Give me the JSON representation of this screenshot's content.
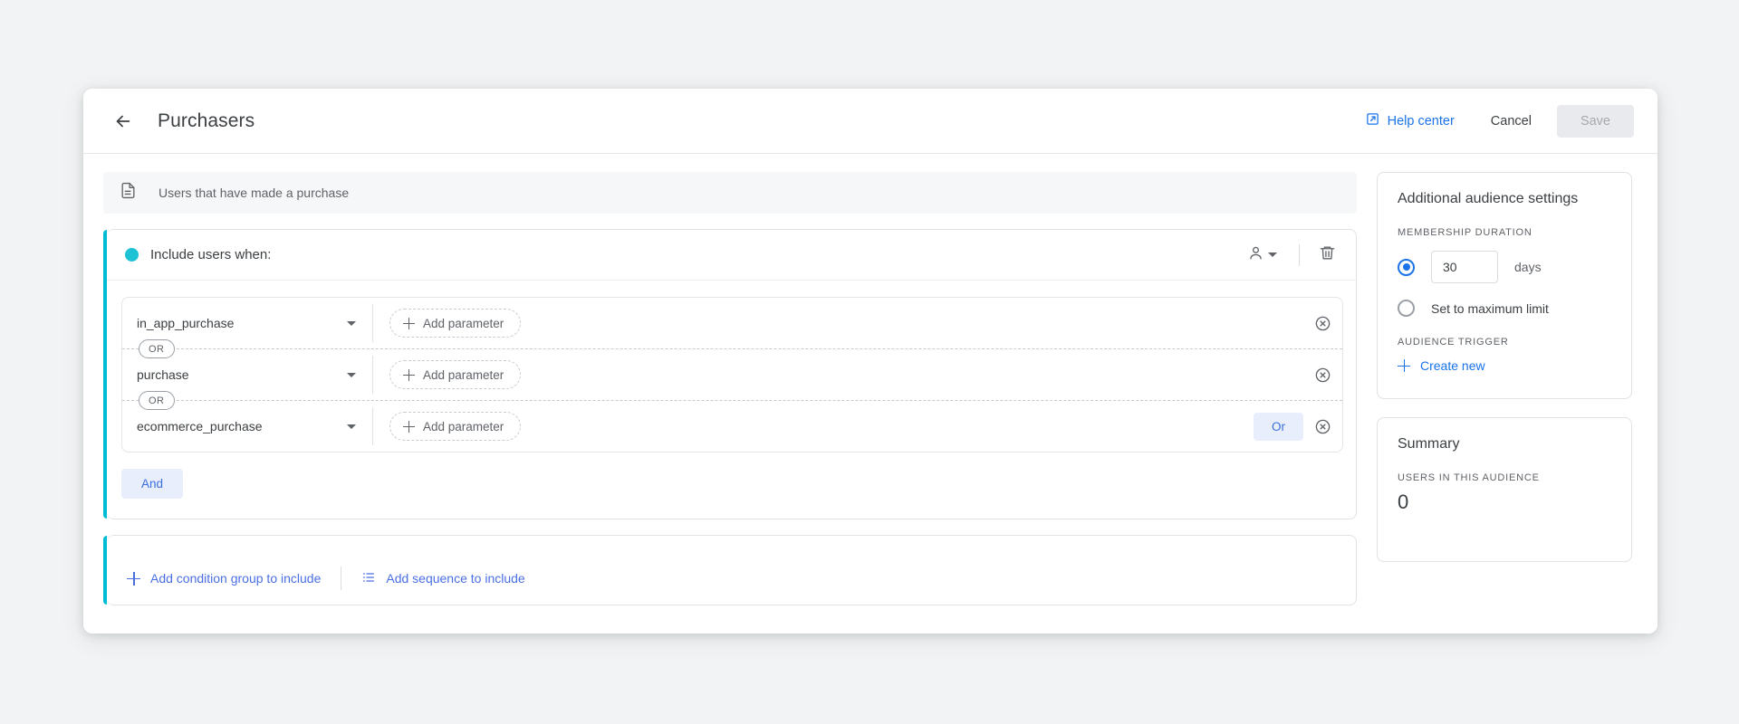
{
  "header": {
    "back_icon": "arrow-left-icon",
    "title": "Purchasers",
    "help_label": "Help center",
    "help_icon": "external-link-icon",
    "cancel_label": "Cancel",
    "save_label": "Save"
  },
  "description": {
    "icon": "document-icon",
    "text": "Users that have made a purchase"
  },
  "include_group": {
    "dot_color": "#1fc1d4",
    "label": "Include users when:",
    "scope_icon": "person-icon",
    "scope_caret_icon": "chevron-down-icon",
    "delete_icon": "trash-icon",
    "conditions": [
      {
        "event": "in_app_purchase",
        "add_parameter_label": "Add parameter",
        "or_button": null,
        "remove_icon": "remove-circle-icon"
      },
      {
        "event": "purchase",
        "add_parameter_label": "Add parameter",
        "or_button": null,
        "remove_icon": "remove-circle-icon"
      },
      {
        "event": "ecommerce_purchase",
        "add_parameter_label": "Add parameter",
        "or_button": "Or",
        "remove_icon": "remove-circle-icon"
      }
    ],
    "separator_label": "OR",
    "and_label": "And"
  },
  "add_bar": {
    "add_condition_group_label": "Add condition group to include",
    "add_condition_group_icon": "plus-icon",
    "add_sequence_label": "Add sequence to include",
    "add_sequence_icon": "list-icon"
  },
  "settings_panel": {
    "title": "Additional audience settings",
    "membership_duration_label": "MEMBERSHIP DURATION",
    "duration_value": "30",
    "duration_unit": "days",
    "duration_selected": true,
    "max_limit_label": "Set to maximum limit",
    "audience_trigger_label": "AUDIENCE TRIGGER",
    "create_new_label": "Create new",
    "create_new_icon": "plus-icon"
  },
  "summary_panel": {
    "title": "Summary",
    "users_label": "USERS IN THIS AUDIENCE",
    "users_value": "0"
  },
  "colors": {
    "accent_teal": "#00bcd4",
    "link_blue": "#1a73e8",
    "chip_blue": "#3b6fe0",
    "chip_bg": "#e8eefc"
  }
}
